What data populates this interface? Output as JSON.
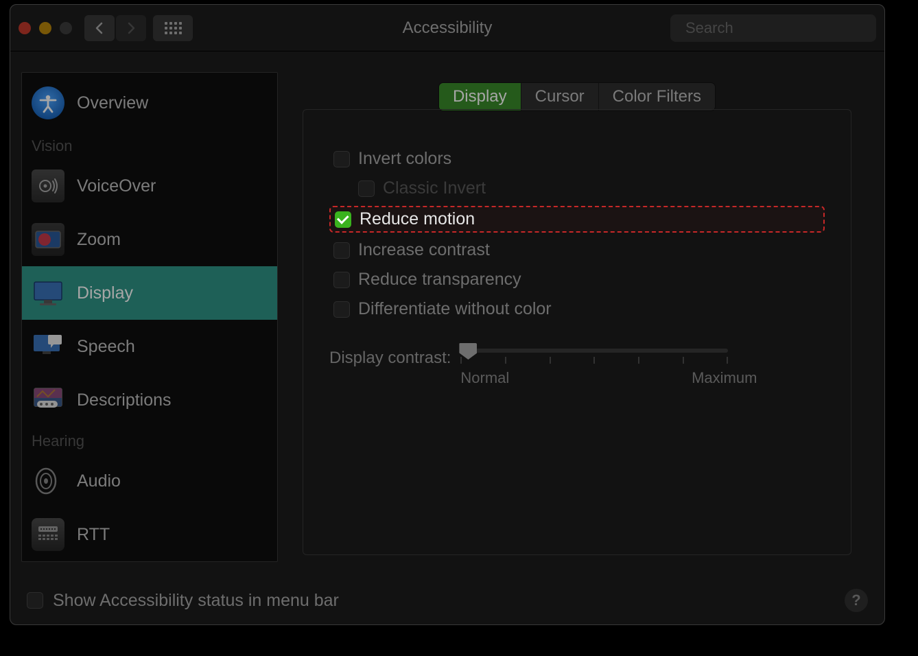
{
  "window": {
    "title": "Accessibility",
    "search_placeholder": "Search"
  },
  "sidebar": {
    "overview_label": "Overview",
    "sections": {
      "vision": {
        "label": "Vision",
        "items": [
          {
            "label": "VoiceOver"
          },
          {
            "label": "Zoom"
          },
          {
            "label": "Display",
            "selected": true
          },
          {
            "label": "Speech"
          },
          {
            "label": "Descriptions"
          }
        ]
      },
      "hearing": {
        "label": "Hearing",
        "items": [
          {
            "label": "Audio"
          },
          {
            "label": "RTT"
          }
        ]
      }
    }
  },
  "tabs": [
    {
      "label": "Display",
      "active": true
    },
    {
      "label": "Cursor",
      "active": false
    },
    {
      "label": "Color Filters",
      "active": false
    }
  ],
  "checkboxes": {
    "invert": {
      "label": "Invert colors",
      "checked": false
    },
    "classic": {
      "label": "Classic Invert",
      "checked": false,
      "disabled": true
    },
    "reduce_motion": {
      "label": "Reduce motion",
      "checked": true,
      "highlighted": true
    },
    "contrast": {
      "label": "Increase contrast",
      "checked": false
    },
    "transparency": {
      "label": "Reduce transparency",
      "checked": false
    },
    "diff_color": {
      "label": "Differentiate without color",
      "checked": false
    }
  },
  "slider": {
    "label": "Display contrast:",
    "min_label": "Normal",
    "max_label": "Maximum",
    "value": 0,
    "ticks": 7
  },
  "footer": {
    "show_status": {
      "label": "Show Accessibility status in menu bar",
      "checked": false
    }
  }
}
